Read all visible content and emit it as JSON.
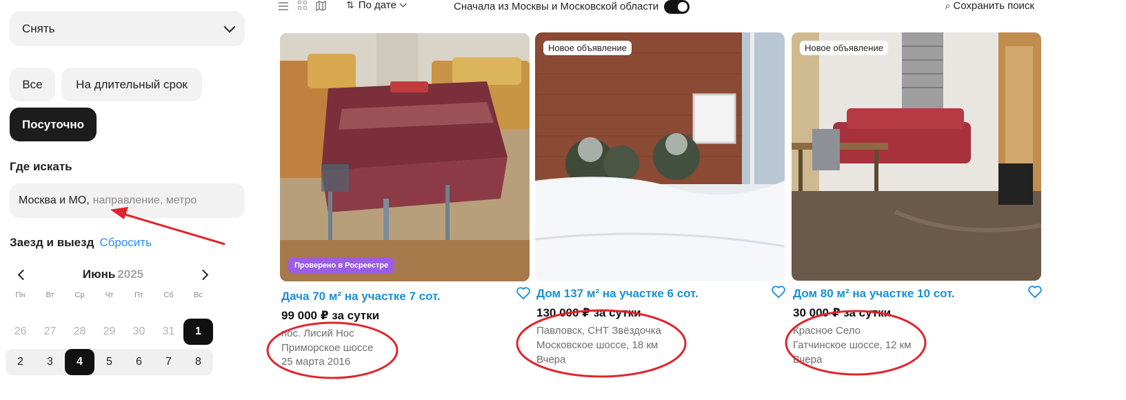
{
  "sidebar": {
    "deal_type": "Снять",
    "rent_chips": [
      "Все",
      "На длительный срок",
      "Посуточно"
    ],
    "where_label": "Где искать",
    "where_value": "Москва и МО,",
    "where_placeholder": "направление, метро",
    "dates_label": "Заезд и выезд",
    "reset_label": "Сбросить",
    "calendar": {
      "month": "Июнь",
      "year": "2025",
      "weekdays": [
        "Пн",
        "Вт",
        "Ср",
        "Чт",
        "Пт",
        "Сб",
        "Вс"
      ],
      "week1": [
        "26",
        "27",
        "28",
        "29",
        "30",
        "31",
        "1"
      ],
      "week2": [
        "2",
        "3",
        "4",
        "5",
        "6",
        "7",
        "8"
      ]
    }
  },
  "toolbar": {
    "sort_label": "По дате",
    "moscow_first_label": "Сначала из Москвы и Московской области",
    "save_search_label": "Сохранить поиск"
  },
  "listings": [
    {
      "badge": "Проверено в Росреестре",
      "title": "Дача 70 м² на участке 7 сот.",
      "price": "99 000 ₽ за сутки",
      "locality": "пос. Лисий Нос",
      "road": "Приморское шоссе",
      "date": "25 марта 2016"
    },
    {
      "badge": "Новое объявление",
      "title": "Дом 137 м² на участке 6 сот.",
      "price": "130 000 ₽ за сутки",
      "locality": "Павловск, СНТ Звёздочка",
      "road": "Московское шоссе, 18 км",
      "date": "Вчера"
    },
    {
      "badge": "Новое объявление",
      "title": "Дом 80 м² на участке 10 сот.",
      "price": "30 000 ₽ за сутки",
      "locality": "Красное Село",
      "road": "Гатчинское шоссе, 12 км",
      "date": "Вчера"
    }
  ],
  "colors": {
    "link": "#1a8fd8",
    "verified_badge": "#9b5de5",
    "annotation": "#e0242b"
  }
}
